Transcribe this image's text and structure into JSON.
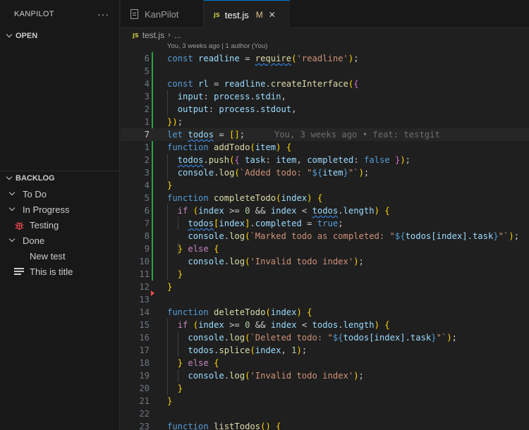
{
  "sidebar": {
    "title": "KANPILOT",
    "more_label": "···",
    "open_section": "OPEN",
    "backlog_section": "BACKLOG",
    "tree": [
      {
        "label": "To Do",
        "kind": "group"
      },
      {
        "label": "In Progress",
        "kind": "group"
      },
      {
        "label": "Testing",
        "kind": "item",
        "icon": "bug-icon"
      },
      {
        "label": "Done",
        "kind": "group"
      },
      {
        "label": "New test",
        "kind": "child"
      },
      {
        "label": "This is title",
        "kind": "item",
        "icon": "list-lines-icon"
      }
    ]
  },
  "tabs": [
    {
      "label": "KanPilot",
      "icon": "document-icon",
      "active": false
    },
    {
      "label": "test.js",
      "icon": "js-file-icon",
      "badge": "JS",
      "modified": "M",
      "active": true
    }
  ],
  "close_label": "✕",
  "breadcrumb": {
    "badge": "JS",
    "file": "test.js",
    "sep": "›",
    "more": "..."
  },
  "editor": {
    "codelens": "You, 3 weeks ago | 1 author (You)",
    "inline_blame": "You, 3 weeks ago • feat: testgit",
    "lines": [
      {
        "n": "6",
        "code": "const readline = require('readline');"
      },
      {
        "n": "5",
        "code": ""
      },
      {
        "n": "4",
        "code": "const rl = readline.createInterface({"
      },
      {
        "n": "3",
        "code": "  input: process.stdin,"
      },
      {
        "n": "2",
        "code": "  output: process.stdout,"
      },
      {
        "n": "1",
        "code": "});"
      },
      {
        "n": "7",
        "code": "let todos = [];"
      },
      {
        "n": "1",
        "code": "function addTodo(item) {"
      },
      {
        "n": "2",
        "code": "  todos.push({ task: item, completed: false });"
      },
      {
        "n": "3",
        "code": "  console.log(`Added todo: \"${item}\"`);"
      },
      {
        "n": "4",
        "code": "}"
      },
      {
        "n": "5",
        "code": "function completeTodo(index) {"
      },
      {
        "n": "6",
        "code": "  if (index >= 0 && index < todos.length) {"
      },
      {
        "n": "7",
        "code": "    todos[index].completed = true;"
      },
      {
        "n": "8",
        "code": "    console.log(`Marked todo as completed: \"${todos[index].task}\"`);"
      },
      {
        "n": "9",
        "code": "  } else {"
      },
      {
        "n": "10",
        "code": "    console.log('Invalid todo index');"
      },
      {
        "n": "11",
        "code": "  }"
      },
      {
        "n": "12",
        "code": "}"
      },
      {
        "n": "13",
        "code": ""
      },
      {
        "n": "14",
        "code": "function deleteTodo(index) {"
      },
      {
        "n": "15",
        "code": "  if (index >= 0 && index < todos.length) {"
      },
      {
        "n": "16",
        "code": "    console.log(`Deleted todo: \"${todos[index].task}\"`);"
      },
      {
        "n": "17",
        "code": "    todos.splice(index, 1);"
      },
      {
        "n": "18",
        "code": "  } else {"
      },
      {
        "n": "19",
        "code": "    console.log('Invalid todo index');"
      },
      {
        "n": "20",
        "code": "  }"
      },
      {
        "n": "21",
        "code": "}"
      },
      {
        "n": "22",
        "code": ""
      },
      {
        "n": "23",
        "code": "function listTodos() {"
      }
    ]
  }
}
